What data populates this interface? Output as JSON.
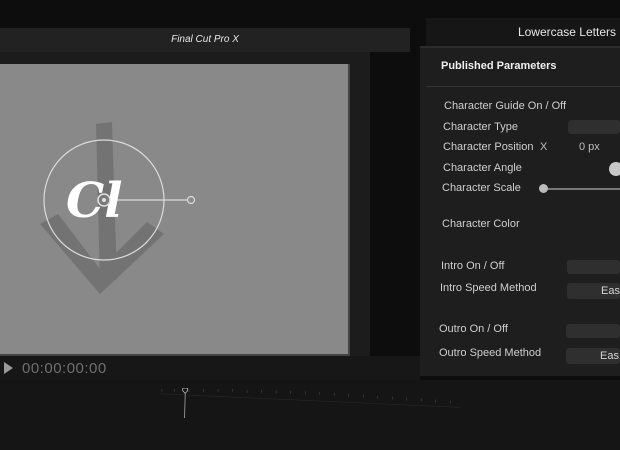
{
  "app": {
    "title": "Final Cut Pro X"
  },
  "viewer": {
    "timecode": "00:00:00:00",
    "glyph": "Cl"
  },
  "inspector": {
    "header": "Lowercase Letters",
    "section_title": "Published Parameters",
    "params": {
      "guide": "Character Guide On / Off",
      "type": "Character Type",
      "position": "Character Position",
      "position_axis": "X",
      "position_value": "0 px",
      "angle": "Character Angle",
      "scale": "Character Scale",
      "color": "Character Color",
      "intro_onoff": "Intro On / Off",
      "intro_speed": "Intro Speed Method",
      "intro_speed_value": "Eas",
      "outro_onoff": "Outro On / Off",
      "outro_speed": "Outro Speed Method",
      "outro_speed_value": "Eas"
    }
  },
  "icons": {
    "play": "play-icon",
    "playhead": "playhead-icon",
    "angle_knob": "angle-knob-icon"
  }
}
